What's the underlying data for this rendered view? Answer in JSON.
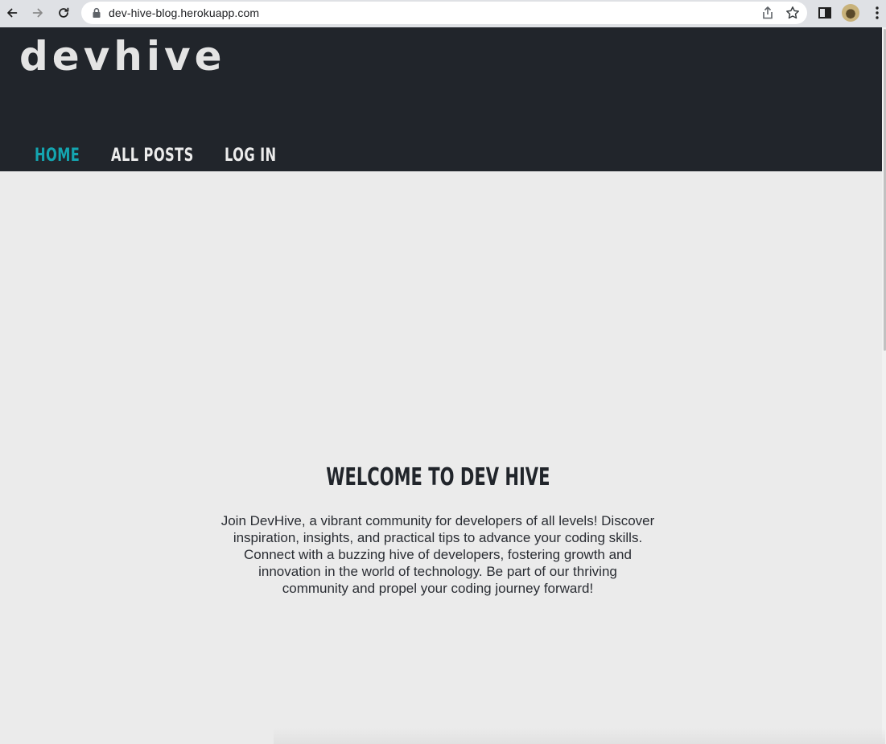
{
  "browser": {
    "url": "dev-hive-blog.herokuapp.com",
    "icons": [
      "back-icon",
      "forward-icon",
      "reload-icon",
      "lock-icon",
      "share-icon",
      "bookmark-star-icon",
      "side-panel-icon",
      "profile-avatar",
      "kebab-menu-icon"
    ]
  },
  "header": {
    "brand": "devhive",
    "nav": [
      {
        "label": "Home",
        "active": true
      },
      {
        "label": "All Posts",
        "active": false
      },
      {
        "label": "Log In",
        "active": false
      }
    ]
  },
  "hero": {
    "title": "Welcome to Dev Hive",
    "description_lines": [
      "Join DevHive, a vibrant community for developers of all levels! Discover",
      "inspiration, insights, and practical tips to advance your coding skills.",
      "Connect with a buzzing hive of developers, fostering growth and",
      "innovation in the world of technology. Be part of our thriving",
      "community and propel your coding journey forward!"
    ]
  },
  "colors": {
    "header_bg": "#21252b",
    "page_bg": "#ebebeb",
    "accent": "#14a5b0",
    "nav_text": "#ececec"
  }
}
